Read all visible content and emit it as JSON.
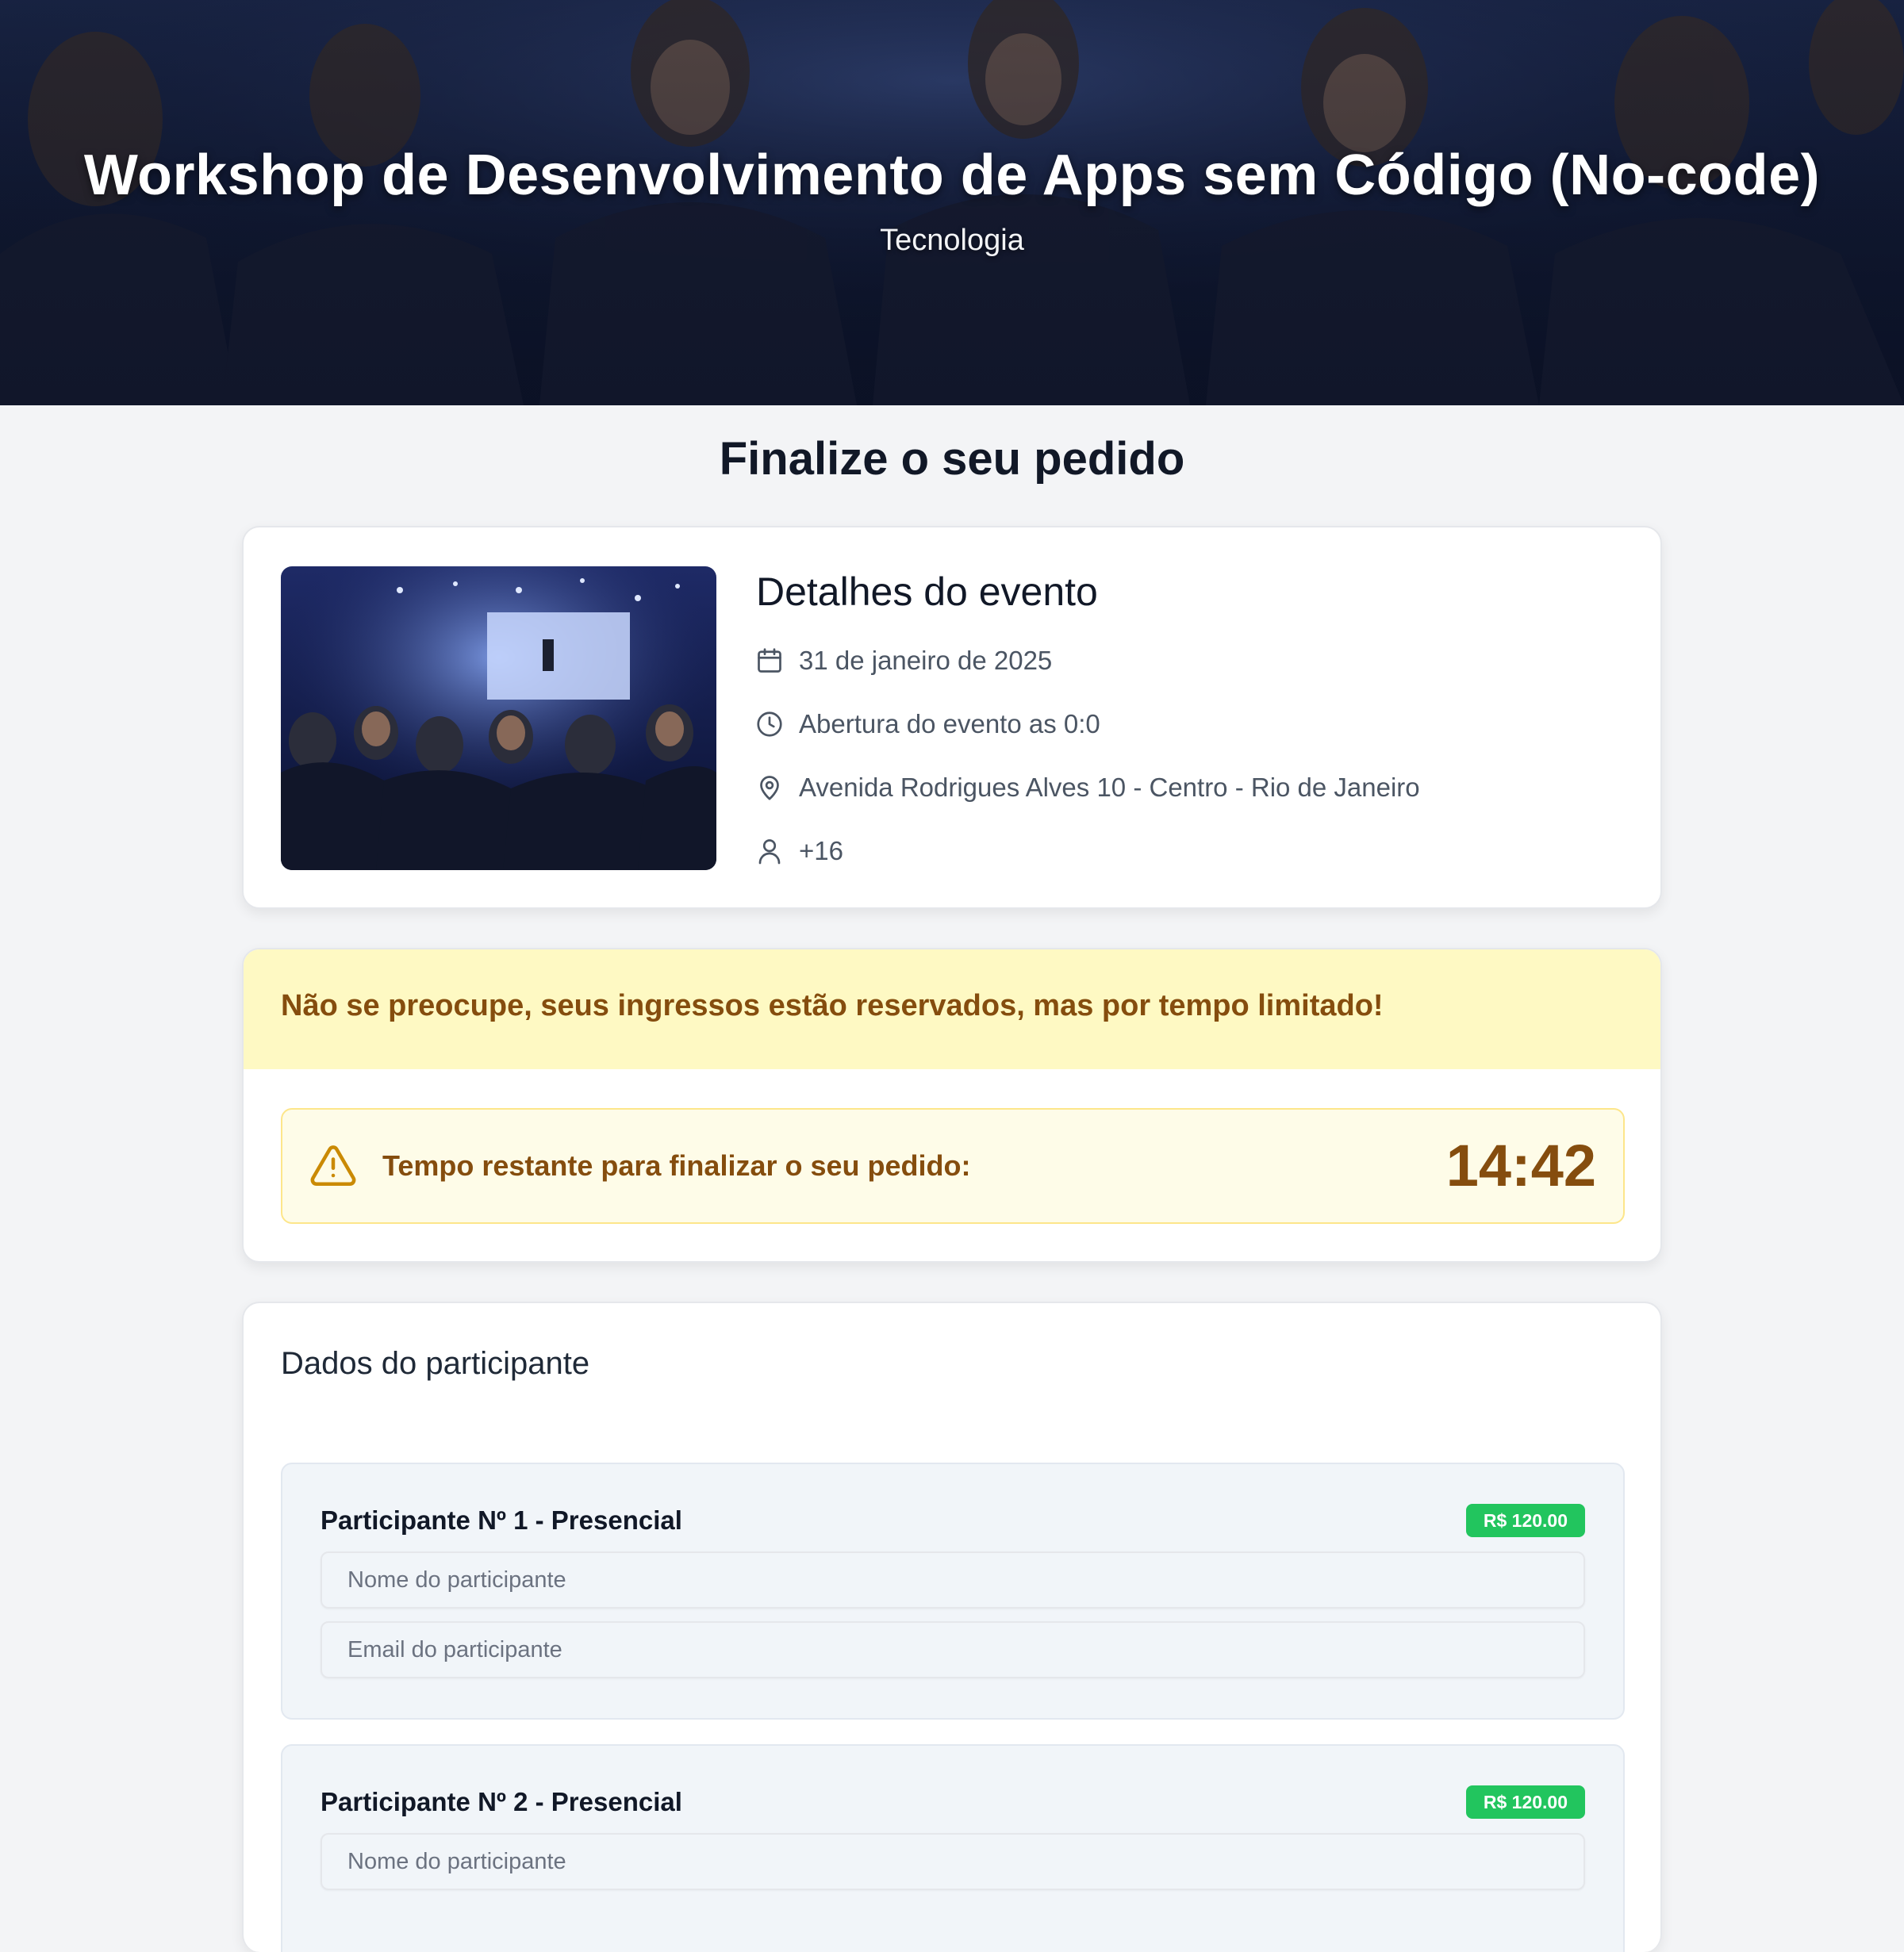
{
  "hero": {
    "title": "Workshop de Desenvolvimento de Apps sem Código (No-code)",
    "category": "Tecnologia"
  },
  "page": {
    "heading": "Finalize o seu pedido"
  },
  "event_details": {
    "title": "Detalhes do evento",
    "date": "31 de janeiro de 2025",
    "opening": "Abertura do evento as 0:0",
    "address": "Avenida Rodrigues Alves 10 - Centro - Rio de Janeiro",
    "age_rating": "+16",
    "icons": [
      "calendar-icon",
      "clock-icon",
      "map-pin-icon",
      "user-icon"
    ]
  },
  "reservation": {
    "banner": "Não se preocupe, seus ingressos estão reservados, mas por tempo limitado!",
    "timer_label": "Tempo restante para finalizar o seu pedido:",
    "timer_value": "14:42",
    "icon": "warning-icon"
  },
  "participants": {
    "title": "Dados do participante",
    "items": [
      {
        "title": "Participante Nº 1 - Presencial",
        "price": "R$ 120.00",
        "name_placeholder": "Nome do participante",
        "email_placeholder": "Email do participante"
      },
      {
        "title": "Participante Nº 2 - Presencial",
        "price": "R$ 120.00",
        "name_placeholder": "Nome do participante"
      }
    ]
  },
  "colors": {
    "banner_bg": "#fef9c3",
    "banner_text": "#854d0e",
    "price_badge": "#22c55e",
    "page_bg": "#f3f4f6"
  }
}
